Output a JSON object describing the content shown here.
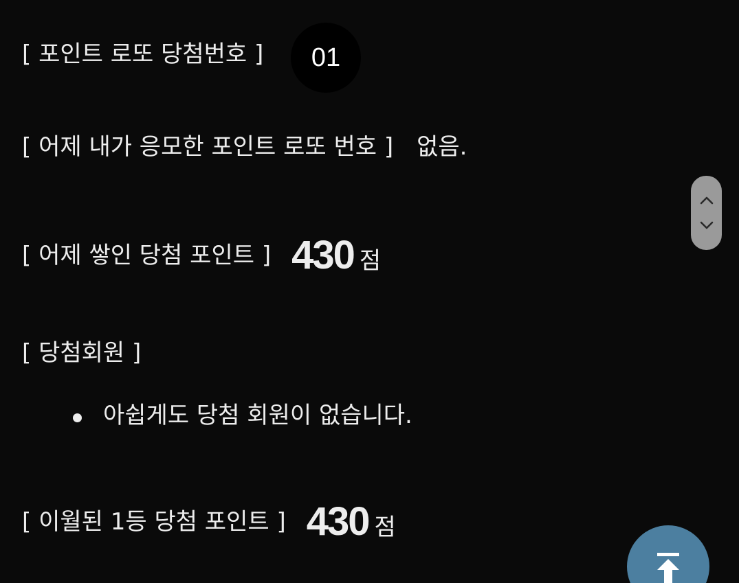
{
  "lotto": {
    "title_label": "[ 포인트 로또 당첨번호 ]",
    "winning_number": "01",
    "my_number_label": "[ 어제 내가 응모한 포인트 로또 번호 ]",
    "my_number_value": "없음.",
    "accumulated_label": "[ 어제 쌓인 당첨 포인트 ]",
    "accumulated_points": "430",
    "accumulated_unit": "점",
    "winners_label": "[ 당첨회원 ]",
    "winners_items": [
      "아쉽게도 당첨 회원이 없습니다."
    ],
    "carry_label": "[ 이월된 1등 당첨 포인트 ]",
    "carry_points": "430",
    "carry_unit": "점"
  },
  "controls": {
    "scroll_up_icon": "chevron-up-icon",
    "scroll_down_icon": "chevron-down-icon",
    "top_button_icon": "arrow-to-top-icon"
  },
  "colors": {
    "background": "#0a0a0a",
    "text": "#ededed",
    "ball": "#000000",
    "scroll_pill": "#9a9a9a",
    "fab": "#4c7fa0"
  }
}
